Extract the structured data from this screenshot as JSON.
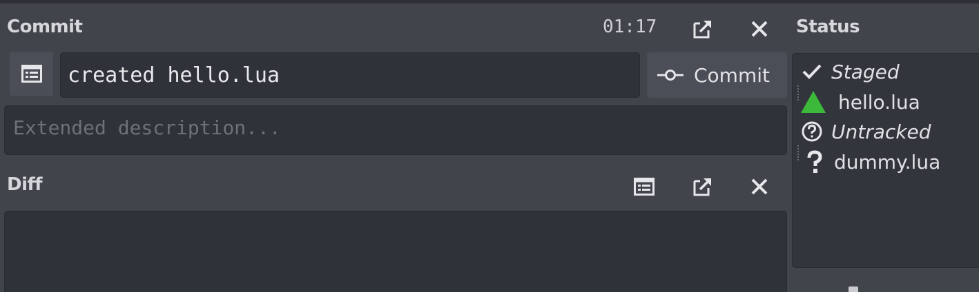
{
  "commit_panel": {
    "title": "Commit",
    "timer": "01:17",
    "summary_value": "created hello.lua",
    "commit_button_label": "Commit",
    "description_placeholder": "Extended description..."
  },
  "diff_panel": {
    "title": "Diff"
  },
  "status_panel": {
    "title": "Status",
    "groups": [
      {
        "label": "Staged",
        "icon": "checkmark-icon",
        "files": [
          {
            "name": "hello.lua",
            "icon": "added-triangle-icon",
            "icon_color": "#3cb83a"
          }
        ]
      },
      {
        "label": "Untracked",
        "icon": "question-circle-icon",
        "files": [
          {
            "name": "dummy.lua",
            "icon": "question-mark-icon"
          }
        ]
      }
    ]
  },
  "colors": {
    "background": "#41444b",
    "input_background": "#30323a",
    "button_background": "#4b4e56",
    "added_green": "#3cb83a"
  }
}
